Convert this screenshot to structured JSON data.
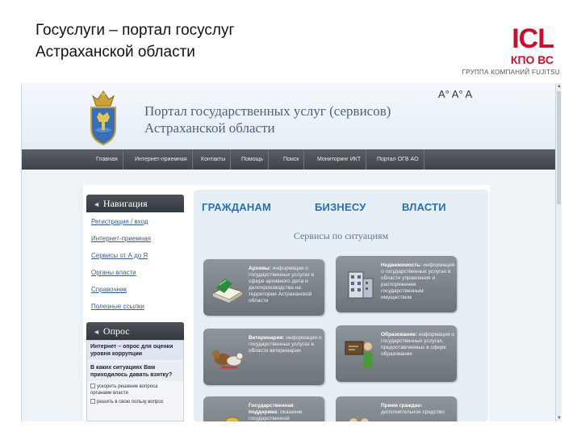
{
  "slide": {
    "title_line1": "Госуслуги – портал госуслуг",
    "title_line2": "Астраханской области"
  },
  "logo": {
    "mark": "ICL",
    "sub": "КПО ВС",
    "group": "ГРУППА КОМПАНИЙ FUJITSU"
  },
  "site": {
    "title_line1": "Портал государственных услуг (сервисов)",
    "title_line2": "Астраханской области",
    "font_size_control": "A° A° A"
  },
  "nav": {
    "items": [
      "Главная",
      "Интернет-приемная",
      "Контакты",
      "Помощь",
      "Поиск",
      "Мониторинг ИКТ",
      "Портал ОГВ АО"
    ]
  },
  "navigation_panel": {
    "title": "Навигация",
    "links": [
      "Регистрация / вход",
      "Интернет-приемная",
      "Сервисы от А до Я",
      "Органы власти",
      "Справочник",
      "Полезные ссылки"
    ]
  },
  "poll_panel": {
    "title": "Опрос",
    "poll_title": "Интернет – опрос для оценки уровня коррупции",
    "question": "В каких ситуациях Вам приходилось давать взятку?",
    "options": [
      "ускорить решение вопроса органами власти",
      "решить в свою пользу вопрос"
    ]
  },
  "tabs": [
    "ГРАЖДАНАМ",
    "БИЗНЕСУ",
    "ВЛАСТИ"
  ],
  "services_title": "Сервисы по ситуациям",
  "cards": [
    {
      "title": "Архивы:",
      "text": "информация о государственных услугах в сфере архивного дела и делопроизводства на территории Астраханской области"
    },
    {
      "title": "Недвижимость:",
      "text": "информация о государственных услугах в области управления и распоряжения государственным имуществом"
    },
    {
      "title": "Ветеринария:",
      "text": "информация о государственных услугах в области ветеринарии"
    },
    {
      "title": "Образование:",
      "text": "информация о государственных услугах, предоставляемых в сфере образования"
    },
    {
      "title": "Государственная поддержка:",
      "text": "оказание государственной"
    },
    {
      "title": "Прием граждан:",
      "text": "дополнительное средство"
    }
  ],
  "colors": {
    "accent": "#2c6fb0",
    "navbar": "#44494e",
    "logo_red": "#c8102e"
  }
}
